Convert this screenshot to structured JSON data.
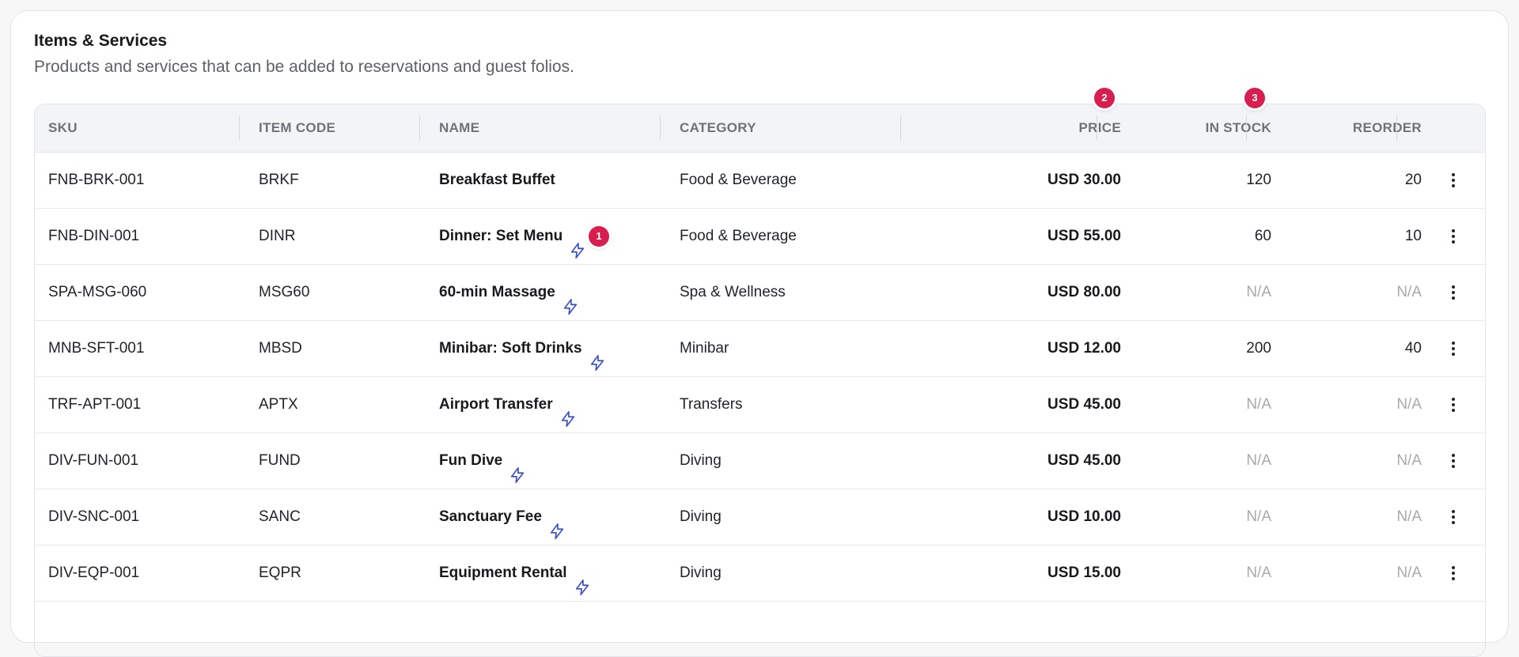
{
  "header": {
    "title": "Items & Services",
    "subtitle": "Products and services that can be added to reservations and guest folios."
  },
  "columns": {
    "sku": "SKU",
    "item_code": "ITEM CODE",
    "name": "NAME",
    "category": "CATEGORY",
    "price": "PRICE",
    "in_stock": "IN STOCK",
    "reorder": "REORDER"
  },
  "markers": [
    "1",
    "2",
    "3"
  ],
  "rows": [
    {
      "sku": "FNB-BRK-001",
      "code": "BRKF",
      "name": "Breakfast Buffet",
      "quick": false,
      "category": "Food & Beverage",
      "price": "USD 30.00",
      "stock": "120",
      "reorder": "20"
    },
    {
      "sku": "FNB-DIN-001",
      "code": "DINR",
      "name": "Dinner: Set Menu",
      "quick": true,
      "category": "Food & Beverage",
      "price": "USD 55.00",
      "stock": "60",
      "reorder": "10"
    },
    {
      "sku": "SPA-MSG-060",
      "code": "MSG60",
      "name": "60-min Massage",
      "quick": true,
      "category": "Spa & Wellness",
      "price": "USD 80.00",
      "stock": "N/A",
      "reorder": "N/A"
    },
    {
      "sku": "MNB-SFT-001",
      "code": "MBSD",
      "name": "Minibar: Soft Drinks",
      "quick": true,
      "category": "Minibar",
      "price": "USD 12.00",
      "stock": "200",
      "reorder": "40"
    },
    {
      "sku": "TRF-APT-001",
      "code": "APTX",
      "name": "Airport Transfer",
      "quick": true,
      "category": "Transfers",
      "price": "USD 45.00",
      "stock": "N/A",
      "reorder": "N/A"
    },
    {
      "sku": "DIV-FUN-001",
      "code": "FUND",
      "name": "Fun Dive",
      "quick": true,
      "category": "Diving",
      "price": "USD 45.00",
      "stock": "N/A",
      "reorder": "N/A"
    },
    {
      "sku": "DIV-SNC-001",
      "code": "SANC",
      "name": "Sanctuary Fee",
      "quick": true,
      "category": "Diving",
      "price": "USD 10.00",
      "stock": "N/A",
      "reorder": "N/A"
    },
    {
      "sku": "DIV-EQP-001",
      "code": "EQPR",
      "name": "Equipment Rental",
      "quick": true,
      "category": "Diving",
      "price": "USD 15.00",
      "stock": "N/A",
      "reorder": "N/A"
    }
  ],
  "icons": {
    "quick_add": "lightning-bolt-icon",
    "row_menu": "more-vertical-icon"
  },
  "colors": {
    "marker": "#d81e4e",
    "bolt": "#3b4fc4",
    "na_text": "#a6a9ae"
  }
}
